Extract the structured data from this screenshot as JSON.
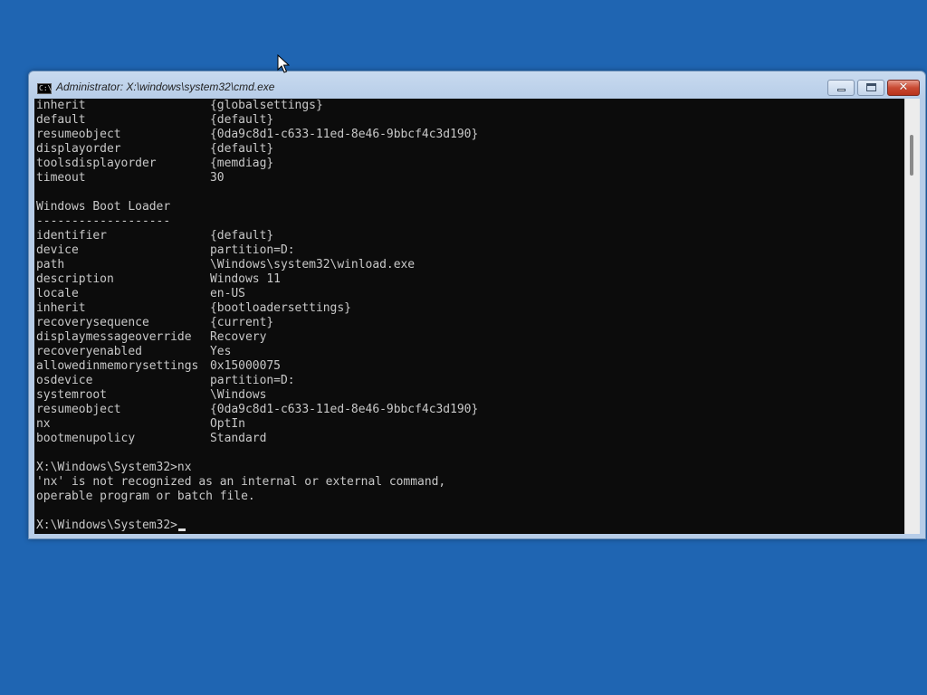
{
  "window": {
    "title": "Administrator: X:\\windows\\system32\\cmd.exe",
    "icon": "cmd-icon",
    "close_glyph": "✕"
  },
  "console": {
    "lines": [
      {
        "key": "inherit",
        "value": "{globalsettings}"
      },
      {
        "key": "default",
        "value": "{default}"
      },
      {
        "key": "resumeobject",
        "value": "{0da9c8d1-c633-11ed-8e46-9bbcf4c3d190}"
      },
      {
        "key": "displayorder",
        "value": "{default}"
      },
      {
        "key": "toolsdisplayorder",
        "value": "{memdiag}"
      },
      {
        "key": "timeout",
        "value": "30"
      },
      {
        "text": ""
      },
      {
        "text": "Windows Boot Loader"
      },
      {
        "text": "-------------------"
      },
      {
        "key": "identifier",
        "value": "{default}"
      },
      {
        "key": "device",
        "value": "partition=D:"
      },
      {
        "key": "path",
        "value": "\\Windows\\system32\\winload.exe"
      },
      {
        "key": "description",
        "value": "Windows 11"
      },
      {
        "key": "locale",
        "value": "en-US"
      },
      {
        "key": "inherit",
        "value": "{bootloadersettings}"
      },
      {
        "key": "recoverysequence",
        "value": "{current}"
      },
      {
        "key": "displaymessageoverride",
        "value": "Recovery"
      },
      {
        "key": "recoveryenabled",
        "value": "Yes"
      },
      {
        "key": "allowedinmemorysettings",
        "value": "0x15000075"
      },
      {
        "key": "osdevice",
        "value": "partition=D:"
      },
      {
        "key": "systemroot",
        "value": "\\Windows"
      },
      {
        "key": "resumeobject",
        "value": "{0da9c8d1-c633-11ed-8e46-9bbcf4c3d190}"
      },
      {
        "key": "nx",
        "value": "OptIn"
      },
      {
        "key": "bootmenupolicy",
        "value": "Standard"
      },
      {
        "text": ""
      },
      {
        "text": "X:\\Windows\\System32>nx"
      },
      {
        "text": "'nx' is not recognized as an internal or external command,"
      },
      {
        "text": "operable program or batch file."
      },
      {
        "text": ""
      }
    ],
    "prompt": "X:\\Windows\\System32>"
  },
  "colors": {
    "desktop": "#1f65b2",
    "console_bg": "#0c0c0c",
    "console_fg": "#c8c8c8"
  }
}
